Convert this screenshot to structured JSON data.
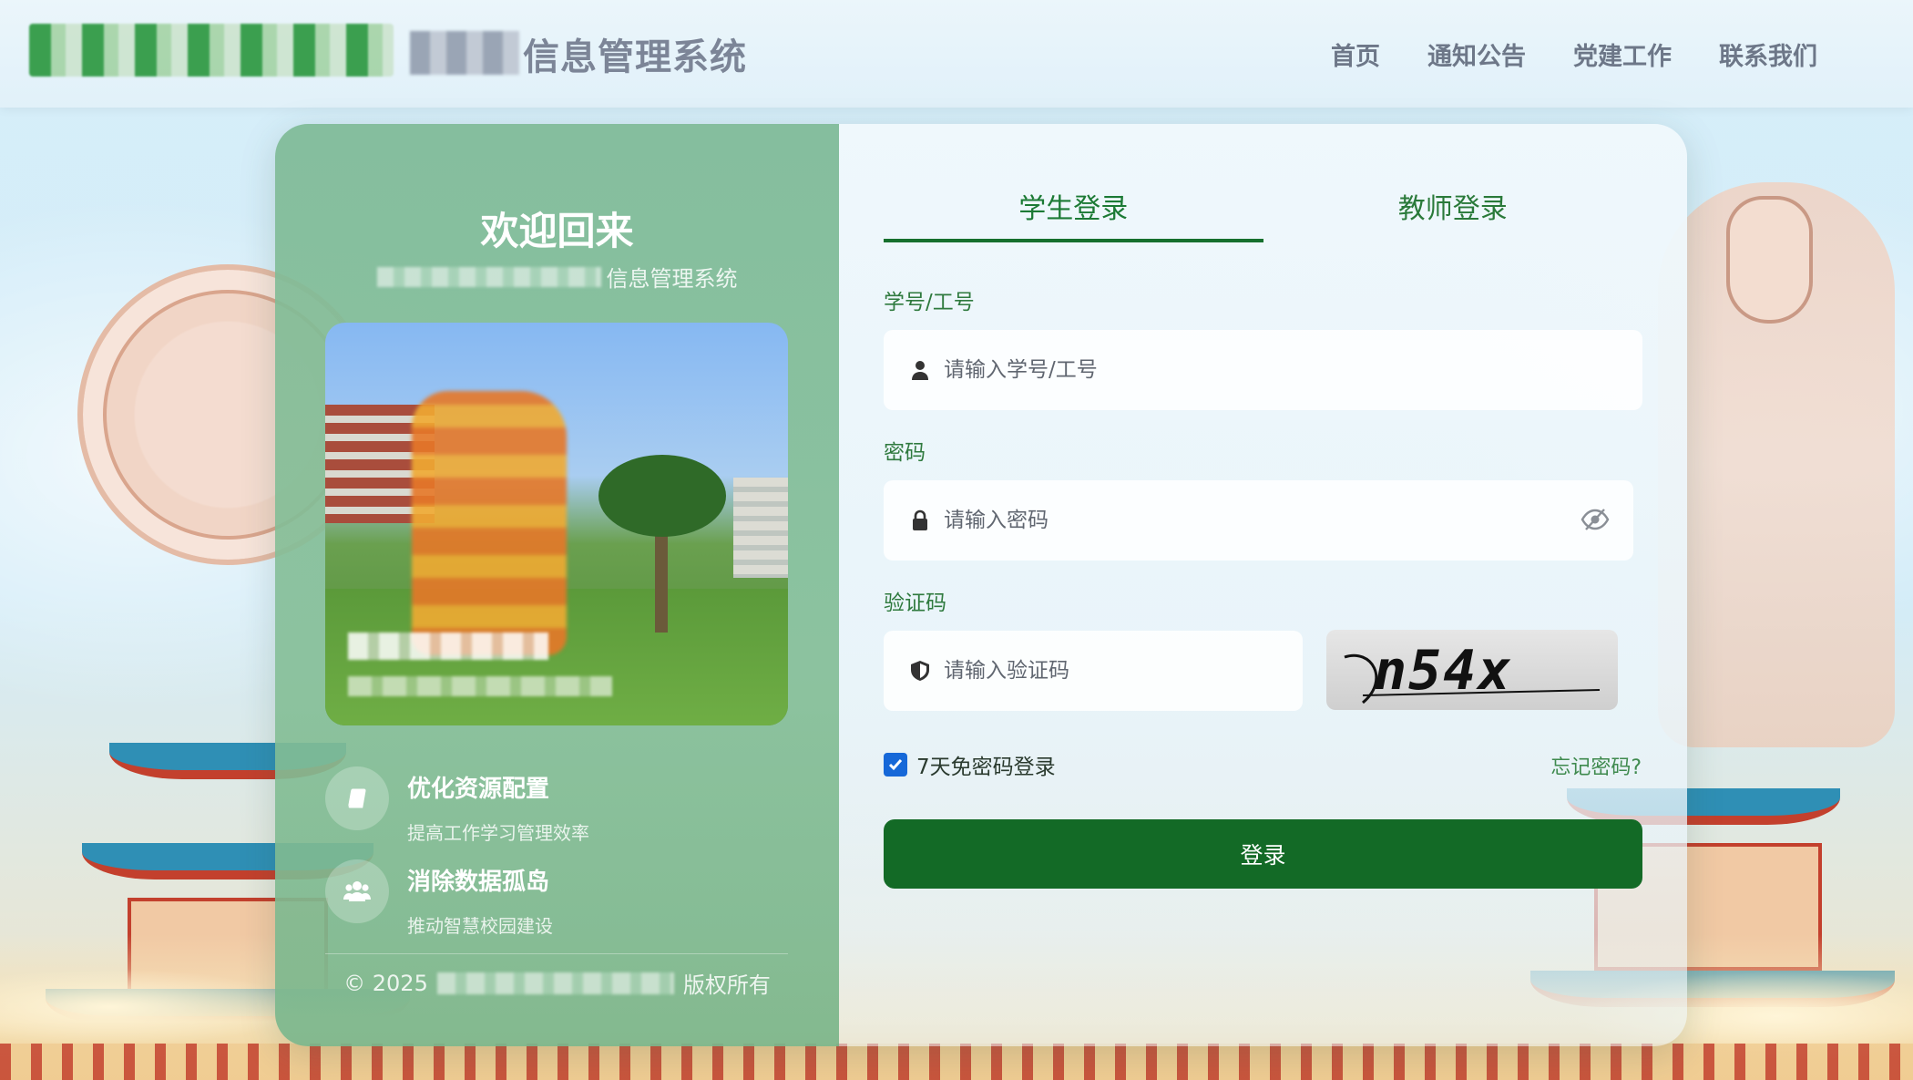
{
  "header": {
    "site_title": "信息管理系统",
    "nav": [
      "首页",
      "通知公告",
      "党建工作",
      "联系我们"
    ]
  },
  "left_panel": {
    "welcome": "欢迎回来",
    "system_name": "信息管理系统",
    "features": [
      {
        "icon": "book-icon",
        "title": "优化资源配置",
        "desc": "提高工作学习管理效率"
      },
      {
        "icon": "users-icon",
        "title": "消除数据孤岛",
        "desc": "推动智慧校园建设"
      }
    ],
    "copyright_prefix": "© 2025",
    "copyright_suffix": "版权所有"
  },
  "login": {
    "tabs": [
      "学生登录",
      "教师登录"
    ],
    "active_tab": "学生登录",
    "id_label": "学号/工号",
    "id_placeholder": "请输入学号/工号",
    "password_label": "密码",
    "password_placeholder": "请输入密码",
    "captcha_label": "验证码",
    "captcha_placeholder": "请输入验证码",
    "captcha_text": "n54x",
    "remember_label": "7天免密码登录",
    "remember_checked": true,
    "forgot_label": "忘记密码?",
    "submit_label": "登录"
  },
  "colors": {
    "primary_green": "#136a26",
    "checkbox_blue": "#1668d8"
  }
}
